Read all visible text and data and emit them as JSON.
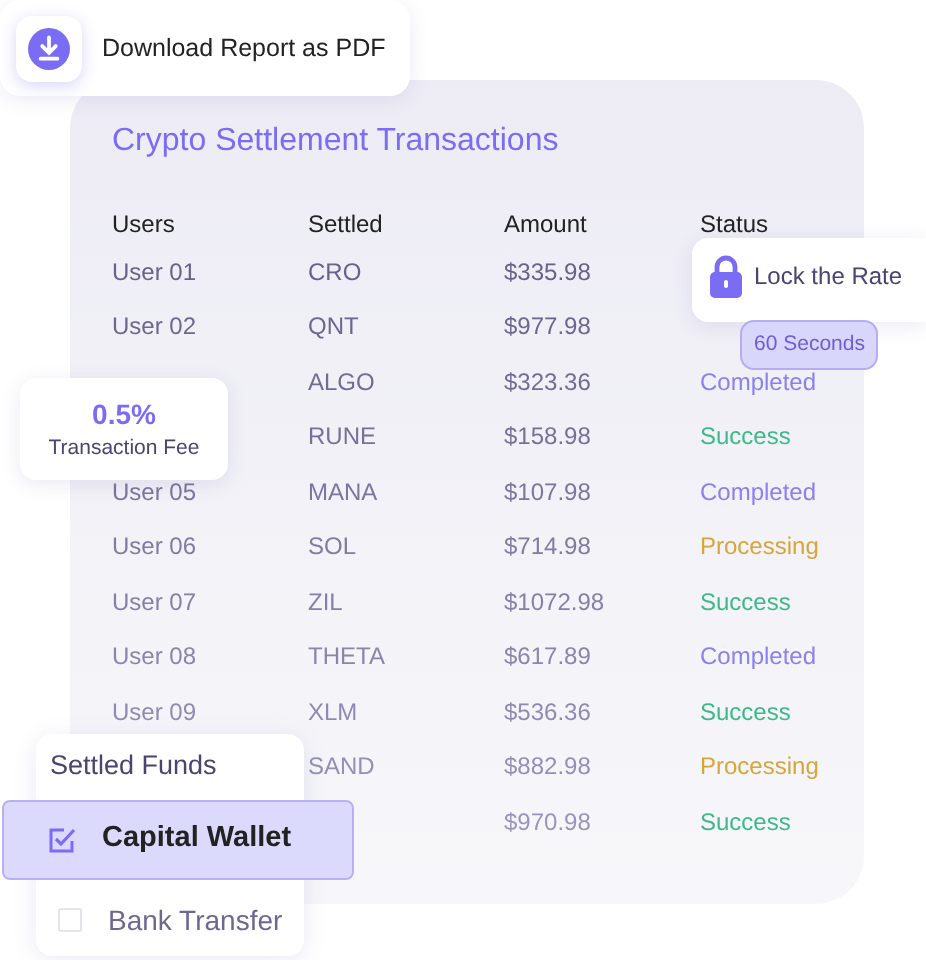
{
  "download_button": {
    "label": "Download Report as PDF"
  },
  "transactions": {
    "title": "Crypto Settlement Transactions",
    "columns": [
      "Users",
      "Settled",
      "Amount",
      "Status"
    ],
    "rows": [
      {
        "user": "User 01",
        "settled": "CRO",
        "amount": "$335.98"
      },
      {
        "user": "User 02",
        "settled": "QNT",
        "amount": "$977.98"
      },
      {
        "settled": "ALGO",
        "amount": "$323.36",
        "status": {
          "text": "Completed",
          "color": "#8a80ee"
        }
      },
      {
        "settled": "RUNE",
        "amount": "$158.98",
        "status": {
          "text": "Success",
          "color": "#3fb888"
        }
      },
      {
        "user": "User 05",
        "settled": "MANA",
        "amount": "$107.98",
        "status": {
          "text": "Completed",
          "color": "#8a80ee"
        }
      },
      {
        "user": "User 06",
        "settled": "SOL",
        "amount": "$714.98",
        "status": {
          "text": "Processing",
          "color": "#d4a63c"
        }
      },
      {
        "user": "User 07",
        "settled": "ZIL",
        "amount": "$1072.98",
        "status": {
          "text": "Success",
          "color": "#3fb888"
        }
      },
      {
        "user": "User 08",
        "settled": "THETA",
        "amount": "$617.89",
        "status": {
          "text": "Completed",
          "color": "#8a80ee"
        }
      },
      {
        "user": "User 09",
        "settled": "XLM",
        "amount": "$536.36",
        "status": {
          "text": "Success",
          "color": "#3fb888"
        }
      },
      {
        "settled": "SAND",
        "amount": "$882.98",
        "status": {
          "text": "Processing",
          "color": "#d4a63c"
        }
      },
      {
        "amount": "$970.98",
        "status": {
          "text": "Success",
          "color": "#3fb888"
        }
      }
    ]
  },
  "lock_rate": {
    "label": "Lock the Rate",
    "badge": "60 Seconds"
  },
  "fee": {
    "value": "0.5%",
    "label": "Transaction Fee"
  },
  "settled_funds": {
    "title": "Settled Funds",
    "options": [
      {
        "label": "Capital Wallet",
        "checked": true,
        "selected": true
      },
      {
        "label": "Bank Transfer",
        "checked": false,
        "selected": false
      }
    ]
  }
}
